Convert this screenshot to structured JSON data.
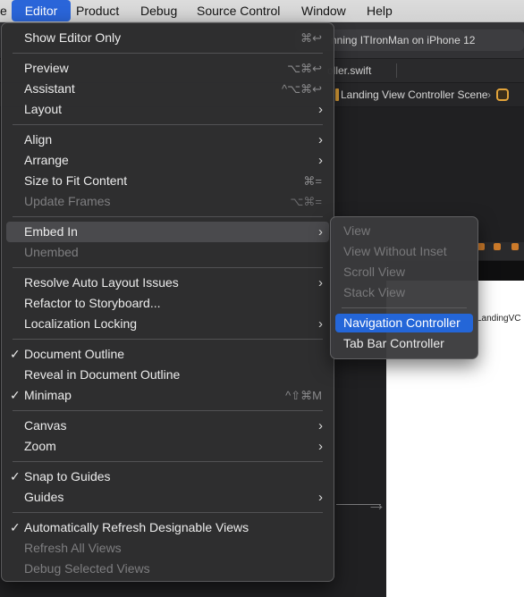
{
  "menubar": {
    "items": [
      "e",
      "Editor",
      "Product",
      "Debug",
      "Source Control",
      "Window",
      "Help"
    ],
    "active_index": 1
  },
  "xcode": {
    "scheme_status": "nning ITIronMan on iPhone 12",
    "tab_file": "oller.swift",
    "jump_scene": "Landing View Controller Scene",
    "scene_label": "LandingVC",
    "icons": {
      "scene": "storyboard-scene-icon",
      "view_controller": "view-controller-icon"
    }
  },
  "editor_menu": {
    "show_editor_only": {
      "label": "Show Editor Only",
      "shortcut": "⌘↩"
    },
    "preview": {
      "label": "Preview",
      "shortcut": "⌥⌘↩"
    },
    "assistant": {
      "label": "Assistant",
      "shortcut": "^⌥⌘↩"
    },
    "layout": {
      "label": "Layout"
    },
    "align": {
      "label": "Align"
    },
    "arrange": {
      "label": "Arrange"
    },
    "size_to_fit": {
      "label": "Size to Fit Content",
      "shortcut": "⌘="
    },
    "update_frames": {
      "label": "Update Frames",
      "shortcut": "⌥⌘="
    },
    "embed_in": {
      "label": "Embed In"
    },
    "unembed": {
      "label": "Unembed"
    },
    "resolve_auto_layout": {
      "label": "Resolve Auto Layout Issues"
    },
    "refactor_storyboard": {
      "label": "Refactor to Storyboard..."
    },
    "localization_locking": {
      "label": "Localization Locking"
    },
    "document_outline": {
      "label": "Document Outline",
      "check": "✓"
    },
    "reveal_outline": {
      "label": "Reveal in Document Outline"
    },
    "minimap": {
      "label": "Minimap",
      "check": "✓",
      "shortcut": "^⇧⌘M"
    },
    "canvas": {
      "label": "Canvas"
    },
    "zoom": {
      "label": "Zoom"
    },
    "snap_to_guides": {
      "label": "Snap to Guides",
      "check": "✓"
    },
    "guides": {
      "label": "Guides"
    },
    "auto_refresh": {
      "label": "Automatically Refresh Designable Views",
      "check": "✓"
    },
    "refresh_all": {
      "label": "Refresh All Views"
    },
    "debug_selected": {
      "label": "Debug Selected Views"
    },
    "submenu_arrow": "›"
  },
  "embed_submenu": {
    "view": "View",
    "view_without_inset": "View Without Inset",
    "scroll_view": "Scroll View",
    "stack_view": "Stack View",
    "navigation_controller": "Navigation Controller",
    "tab_bar_controller": "Tab Bar Controller"
  },
  "colors": {
    "selection": "#2466d8",
    "menu_bg": "#2e2e30",
    "accent_orange": "#e2a33a"
  }
}
